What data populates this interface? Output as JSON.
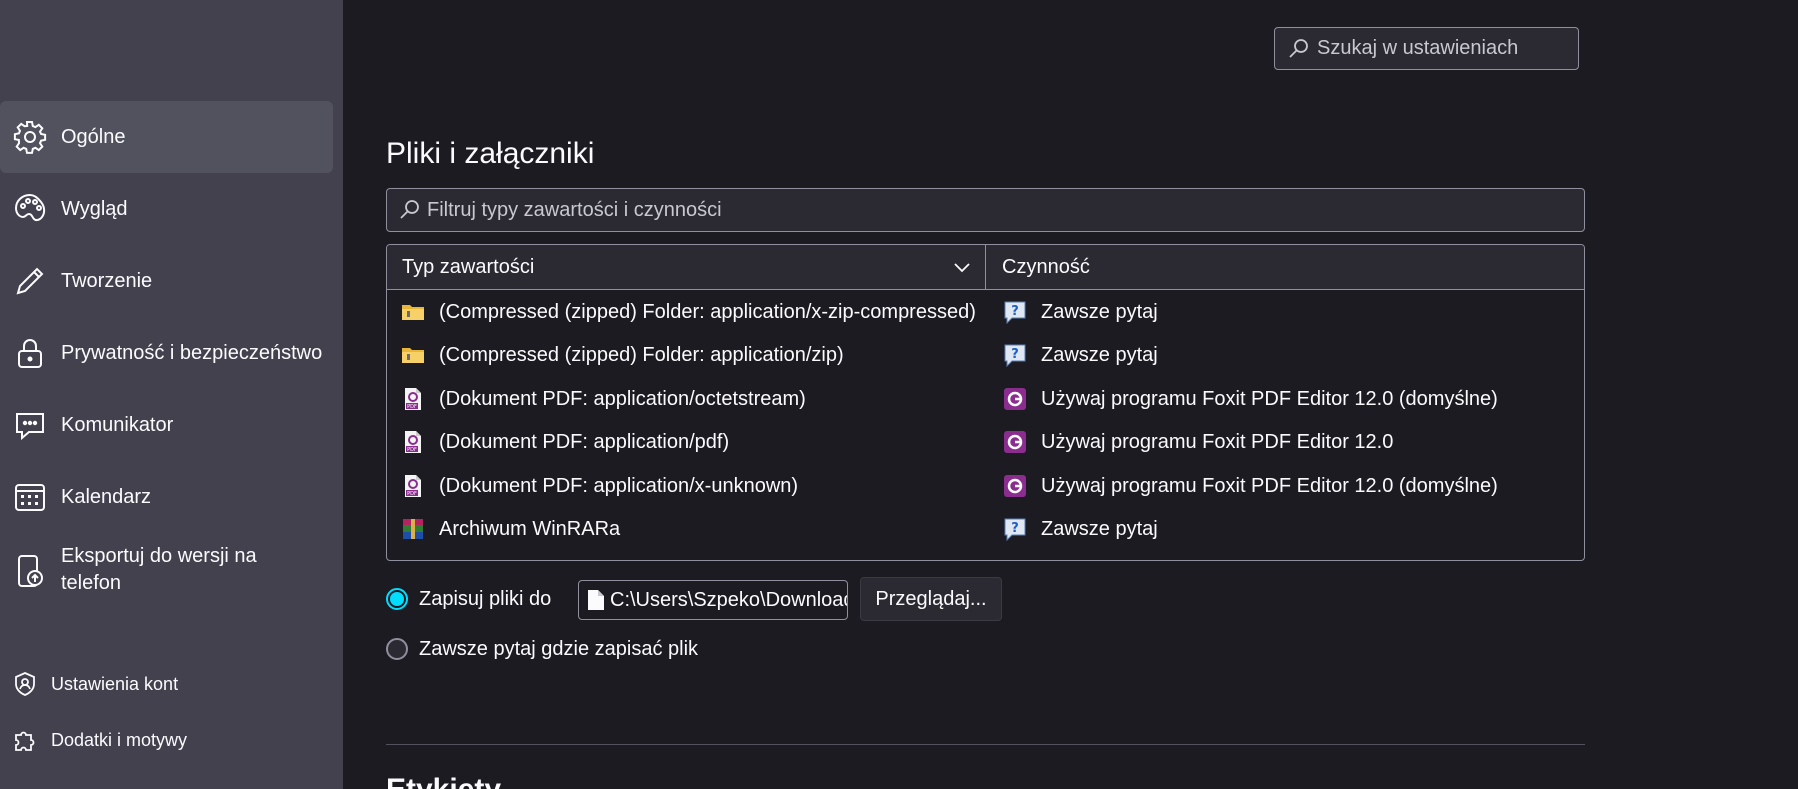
{
  "sidebar": {
    "items": [
      {
        "label": "Ogólne",
        "icon": "gear-icon"
      },
      {
        "label": "Wygląd",
        "icon": "palette-icon"
      },
      {
        "label": "Tworzenie",
        "icon": "pencil-icon"
      },
      {
        "label": "Prywatność i bezpieczeństwo",
        "icon": "lock-icon"
      },
      {
        "label": "Komunikator",
        "icon": "chat-icon"
      },
      {
        "label": "Kalendarz",
        "icon": "calendar-icon"
      },
      {
        "label_line1": "Eksportuj do wersji na",
        "label_line2": "telefon",
        "icon": "phone-export-icon"
      }
    ],
    "footer": [
      {
        "label": "Ustawienia kont",
        "icon": "account-settings-icon"
      },
      {
        "label": "Dodatki i motywy",
        "icon": "puzzle-icon"
      }
    ]
  },
  "search": {
    "placeholder": "Szukaj w ustawieniach"
  },
  "section": {
    "title": "Pliki i załączniki",
    "filter_placeholder": "Filtruj typy zawartości i czynności",
    "columns": {
      "type": "Typ zawartości",
      "action": "Czynność"
    },
    "rows": [
      {
        "type": "(Compressed (zipped) Folder: application/x-zip-compressed)",
        "type_icon": "zip-folder-icon",
        "action": "Zawsze pytaj",
        "action_icon": "ask-icon"
      },
      {
        "type": "(Compressed (zipped) Folder: application/zip)",
        "type_icon": "zip-folder-icon",
        "action": "Zawsze pytaj",
        "action_icon": "ask-icon"
      },
      {
        "type": "(Dokument PDF: application/octetstream)",
        "type_icon": "pdf-file-icon",
        "action": "Używaj programu Foxit PDF Editor 12.0 (domyślne)",
        "action_icon": "foxit-icon"
      },
      {
        "type": "(Dokument PDF: application/pdf)",
        "type_icon": "pdf-file-icon",
        "action": "Używaj programu Foxit PDF Editor 12.0",
        "action_icon": "foxit-icon"
      },
      {
        "type": "(Dokument PDF: application/x-unknown)",
        "type_icon": "pdf-file-icon",
        "action": "Używaj programu Foxit PDF Editor 12.0 (domyślne)",
        "action_icon": "foxit-icon"
      },
      {
        "type": "Archiwum WinRARa",
        "type_icon": "winrar-icon",
        "action": "Zawsze pytaj",
        "action_icon": "ask-icon"
      }
    ],
    "save_to_label": "Zapisuj pliki do",
    "save_path": "C:\\Users\\Szpeko\\Downloads",
    "browse_label": "Przeglądaj...",
    "always_ask_label": "Zawsze pytaj gdzie zapisać plik",
    "selected_option": "save_to"
  },
  "next_section": {
    "title": "Etykiety"
  },
  "colors": {
    "accent": "#00ddff",
    "sidebar_bg": "#42414d",
    "page_bg": "#1c1b22",
    "foxit": "#8b2d8f"
  }
}
